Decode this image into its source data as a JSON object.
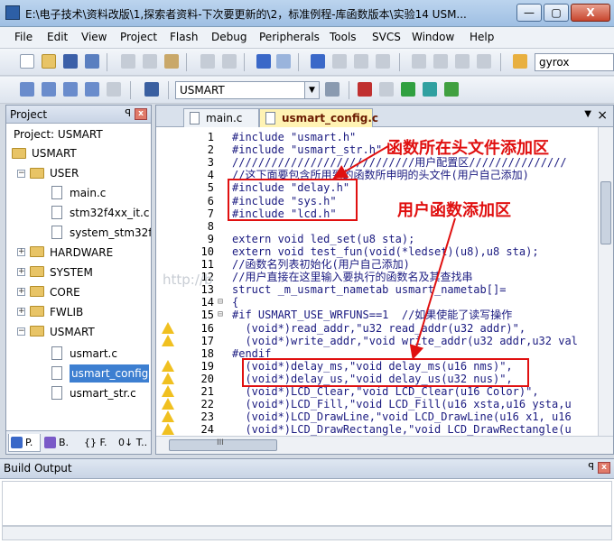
{
  "window": {
    "title": "E:\\电子技术\\资料改版\\1,探索者资料-下次要更新的\\2，标准例程-库函数版本\\实验14 USM...",
    "min": "—",
    "max": "▢",
    "close": "X"
  },
  "menu": [
    "File",
    "Edit",
    "View",
    "Project",
    "Flash",
    "Debug",
    "Peripherals",
    "Tools",
    "SVCS",
    "Window",
    "Help"
  ],
  "toolbar": {
    "find_value": "gyrox",
    "target": "USMART"
  },
  "project": {
    "panel_title": "Project",
    "pin": "ꟼ",
    "close": "x",
    "root": "Project: USMART",
    "target": "USMART",
    "groups": {
      "user": "USER",
      "hardware": "HARDWARE",
      "system": "SYSTEM",
      "core": "CORE",
      "fwlib": "FWLIB",
      "usmart": "USMART"
    },
    "user_files": [
      "main.c",
      "stm32f4xx_it.c",
      "system_stm32f"
    ],
    "usmart_files": [
      "usmart.c",
      "usmart_config",
      "usmart_str.c"
    ],
    "tabs": [
      "P.",
      "B.",
      "{} F.",
      "0↓ T.."
    ]
  },
  "editor": {
    "tabs": [
      "main.c",
      "usmart_config.c"
    ],
    "tab_menu": "▼",
    "tab_close": "×",
    "lines": [
      {
        "n": "1",
        "fold": "",
        "warn": false,
        "t": "#include \"usmart.h\""
      },
      {
        "n": "2",
        "fold": "",
        "warn": false,
        "t": "#include \"usmart_str.h\""
      },
      {
        "n": "3",
        "fold": "",
        "warn": false,
        "t": "////////////////////////////用户配置区///////////////"
      },
      {
        "n": "4",
        "fold": "",
        "warn": false,
        "t": "//这下面要包含所用到的函数所申明的头文件(用户自己添加)"
      },
      {
        "n": "5",
        "fold": "",
        "warn": false,
        "t": "#include \"delay.h\""
      },
      {
        "n": "6",
        "fold": "",
        "warn": false,
        "t": "#include \"sys.h\""
      },
      {
        "n": "7",
        "fold": "",
        "warn": false,
        "t": "#include \"lcd.h\""
      },
      {
        "n": "8",
        "fold": "",
        "warn": false,
        "t": ""
      },
      {
        "n": "9",
        "fold": "",
        "warn": false,
        "t": "extern void led_set(u8 sta);"
      },
      {
        "n": "10",
        "fold": "",
        "warn": false,
        "t": "extern void test_fun(void(*ledset)(u8),u8 sta);"
      },
      {
        "n": "11",
        "fold": "",
        "warn": false,
        "t": "//函数名列表初始化(用户自己添加)"
      },
      {
        "n": "12",
        "fold": "",
        "warn": false,
        "t": "//用户直接在这里输入要执行的函数名及其查找串"
      },
      {
        "n": "13",
        "fold": "",
        "warn": false,
        "t": "struct _m_usmart_nametab usmart_nametab[]="
      },
      {
        "n": "14",
        "fold": "⊟",
        "warn": false,
        "t": "{"
      },
      {
        "n": "15",
        "fold": "⊟",
        "warn": false,
        "t": "#if USMART_USE_WRFUNS==1  //如果使能了读写操作"
      },
      {
        "n": "16",
        "fold": "",
        "warn": true,
        "t": "  (void*)read_addr,\"u32 read_addr(u32 addr)\","
      },
      {
        "n": "17",
        "fold": "",
        "warn": true,
        "t": "  (void*)write_addr,\"void write_addr(u32 addr,u32 val"
      },
      {
        "n": "18",
        "fold": "",
        "warn": false,
        "t": "#endif"
      },
      {
        "n": "19",
        "fold": "",
        "warn": true,
        "t": "  (void*)delay_ms,\"void delay_ms(u16 nms)\","
      },
      {
        "n": "20",
        "fold": "",
        "warn": true,
        "t": "  (void*)delay_us,\"void delay_us(u32 nus)\","
      },
      {
        "n": "21",
        "fold": "",
        "warn": true,
        "t": "  (void*)LCD_Clear,\"void LCD_Clear(u16 Color)\","
      },
      {
        "n": "22",
        "fold": "",
        "warn": true,
        "t": "  (void*)LCD_Fill,\"void LCD_Fill(u16 xsta,u16 ysta,u"
      },
      {
        "n": "23",
        "fold": "",
        "warn": true,
        "t": "  (void*)LCD_DrawLine,\"void LCD_DrawLine(u16 x1, u16"
      },
      {
        "n": "24",
        "fold": "",
        "warn": true,
        "t": "  (void*)LCD_DrawRectangle,\"void LCD_DrawRectangle(u"
      }
    ],
    "hscroll_label": "III"
  },
  "annotations": {
    "header_area": "函数所在头文件添加区",
    "function_area": "用户函数添加区",
    "watermark": "http://b"
  },
  "build": {
    "title": "Build Output",
    "pin": "ꟼ",
    "close": "x"
  },
  "colors": {
    "annotation": "#e01010",
    "selection": "#3d7fd1",
    "active_tab": "#fff3b4"
  }
}
